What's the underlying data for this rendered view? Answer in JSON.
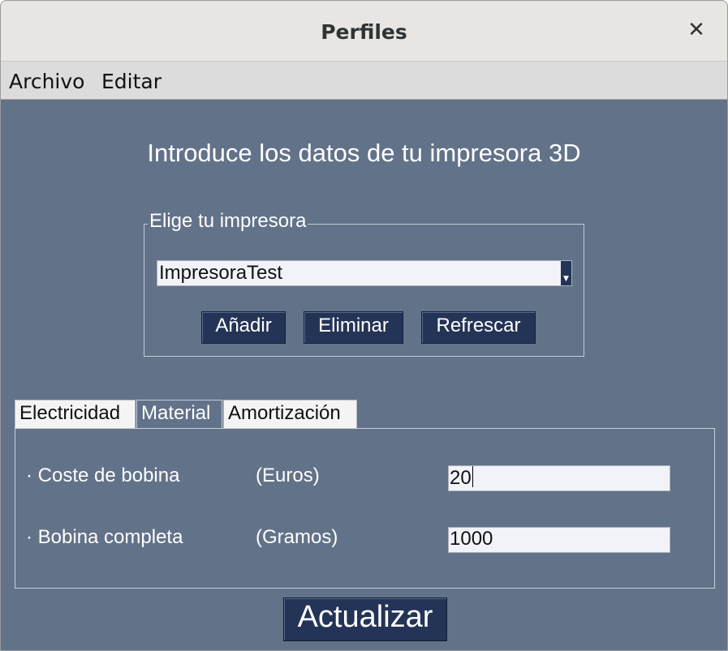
{
  "window": {
    "title": "Perfiles",
    "close_icon": "close-icon"
  },
  "menubar": {
    "items": [
      {
        "label": "Archivo"
      },
      {
        "label": "Editar"
      }
    ]
  },
  "main": {
    "heading": "Introduce los datos de tu impresora 3D",
    "printer_group": {
      "legend": "Elige tu impresora",
      "selected_printer": "ImpresoraTest",
      "buttons": {
        "add": "Añadir",
        "delete": "Eliminar",
        "refresh": "Refrescar"
      }
    },
    "tabs": [
      {
        "label": "Electricidad",
        "active": false
      },
      {
        "label": "Material",
        "active": true
      },
      {
        "label": "Amortización",
        "active": false
      }
    ],
    "material_panel": {
      "rows": [
        {
          "label": "· Coste de bobina",
          "unit": "(Euros)",
          "value": "20"
        },
        {
          "label": "· Bobina completa",
          "unit": "(Gramos)",
          "value": "1000"
        }
      ]
    },
    "update_button": "Actualizar"
  },
  "colors": {
    "background": "#627289",
    "button": "#243456",
    "input": "#f1f3f8",
    "titlebar": "#e8e6e3",
    "menubar": "#dcdcdc"
  }
}
